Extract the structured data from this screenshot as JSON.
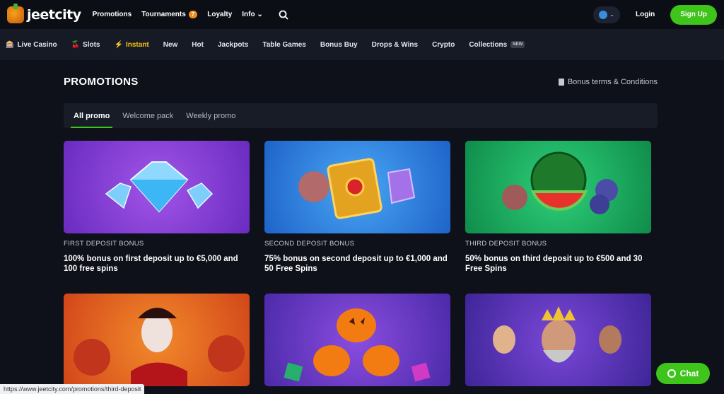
{
  "header": {
    "logo_text": "jeetcity",
    "nav": [
      {
        "label": "Promotions"
      },
      {
        "label": "Tournaments",
        "badge": "7"
      },
      {
        "label": "Loyalty"
      },
      {
        "label": "Info ⌄"
      }
    ],
    "login_label": "Login",
    "signup_label": "Sign Up"
  },
  "categories": [
    {
      "label": "Live Casino",
      "icon": "🎰"
    },
    {
      "label": "Slots",
      "icon": "🍒"
    },
    {
      "label": "Instant",
      "icon": "⚡"
    },
    {
      "label": "New"
    },
    {
      "label": "Hot"
    },
    {
      "label": "Jackpots"
    },
    {
      "label": "Table Games"
    },
    {
      "label": "Bonus Buy"
    },
    {
      "label": "Drops & Wins"
    },
    {
      "label": "Crypto"
    },
    {
      "label": "Collections",
      "badge": "NEW"
    }
  ],
  "page": {
    "title": "PROMOTIONS",
    "terms_label": "Bonus terms & Conditions",
    "tabs": [
      "All promo",
      "Welcome pack",
      "Weekly promo"
    ]
  },
  "cards": [
    {
      "subtitle": "FIRST DEPOSIT BONUS",
      "title": "100% bonus on first deposit up to €5,000 and 100 free spins"
    },
    {
      "subtitle": "SECOND DEPOSIT BONUS",
      "title": "75% bonus on second deposit up to €1,000 and 50 Free Spins"
    },
    {
      "subtitle": "THIRD DEPOSIT BONUS",
      "title": "50% bonus on third deposit up to €500 and 30 Free Spins"
    },
    {
      "subtitle": "",
      "title": ""
    },
    {
      "subtitle": "",
      "title": ""
    },
    {
      "subtitle": "",
      "title": ""
    }
  ],
  "status_url": "https://www.jeetcity.com/promotions/third-deposit",
  "chat_label": "Chat",
  "colors": {
    "accent_green": "#3ec41a",
    "active_category": "#f5c11a"
  }
}
